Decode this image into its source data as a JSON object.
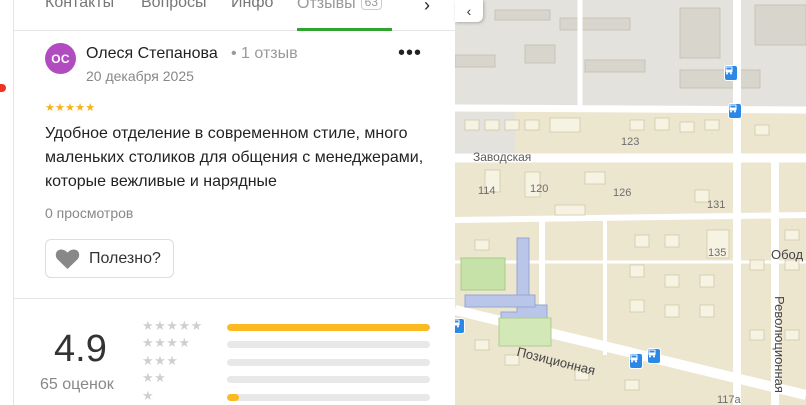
{
  "tabs": [
    {
      "label": "Контакты"
    },
    {
      "label": "Вопросы"
    },
    {
      "label": "Инфо"
    },
    {
      "label": "Отзывы",
      "badge": "63",
      "active": true
    }
  ],
  "review": {
    "avatar_initials": "ОС",
    "avatar_color": "#b04cc0",
    "author": "Олеся Степанова",
    "meta": "• 1 отзыв",
    "date": "20 декабря 2025",
    "rating": 5,
    "stars": "★★★★★",
    "text": "Удобное отделение в современном стиле, много маленьких столиков для общения с менеджерами, которые вежливые и нарядные",
    "views": "0 просмотров",
    "helpful_label": "Полезно?",
    "more_label": "•••"
  },
  "summary": {
    "rating": "4.9",
    "count_label": "65 оценок",
    "distribution": [
      {
        "stars": "★★★★★",
        "share": 1.0
      },
      {
        "stars": "★★★★",
        "share": 0.0
      },
      {
        "stars": "★★★",
        "share": 0.0
      },
      {
        "stars": "★★",
        "share": 0.0
      },
      {
        "stars": "★",
        "share": 0.06
      }
    ]
  },
  "map": {
    "streets": [
      "Заводская",
      "Позиционная",
      "Революционная",
      "Обод"
    ],
    "house_numbers": [
      "123",
      "114",
      "120",
      "126",
      "131",
      "135",
      "117а"
    ],
    "accent": "#2c88e6"
  },
  "colors": {
    "accent_green": "#2ea52e",
    "star_gold": "#fbba21"
  }
}
